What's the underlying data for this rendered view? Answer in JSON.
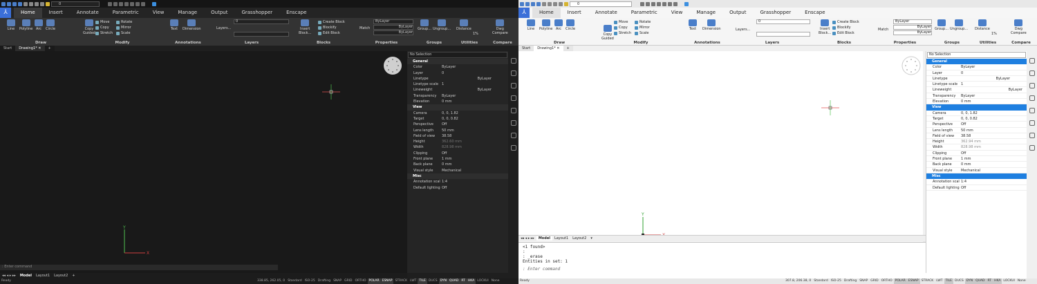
{
  "qat": {
    "layer_value": "0"
  },
  "tabs": [
    "Home",
    "Insert",
    "Annotate",
    "Parametric",
    "View",
    "Manage",
    "Output",
    "Grasshopper",
    "Enscape"
  ],
  "ribbon": {
    "groups": {
      "draw": "Draw",
      "modify": "Modify",
      "annotations": "Annotations",
      "layers": "Layers",
      "blocks": "Blocks",
      "properties": "Properties",
      "groups": "Groups",
      "utilities": "Utilities",
      "compare": "Compare"
    },
    "draw": [
      "Line",
      "Polyline",
      "Arc",
      "Circle"
    ],
    "modify_big": [
      "Copy",
      "Guided"
    ],
    "modify_small": [
      "Move",
      "Rotate",
      "Copy",
      "Mirror",
      "Stretch",
      "Scale"
    ],
    "annot": [
      "Text",
      "Dimension"
    ],
    "layers_btn": "Layers...",
    "layer_value": "0",
    "blocks": {
      "insert": "Insert",
      "insert2": "Block...",
      "create": "Create Block",
      "blockify": "Blockify",
      "edit": "Edit Block"
    },
    "match": "Match",
    "bylayer": [
      "ByLayer",
      "ByLayer",
      "ByLayer"
    ],
    "groups_btn": [
      "Group...",
      "Ungroup..."
    ],
    "distance": "Distance",
    "percent": "1%",
    "dwg": [
      "Dwg",
      "Compare"
    ]
  },
  "doc_tabs": [
    "Start",
    "Drawing1*"
  ],
  "props": {
    "selection": "No Selection",
    "sections": [
      {
        "title": "General",
        "rows": [
          [
            "Color",
            "ByLayer"
          ],
          [
            "Layer",
            "0"
          ],
          [
            "Linetype",
            "ByLayer"
          ],
          [
            "Linetype scale",
            "1"
          ],
          [
            "Lineweight",
            "ByLayer"
          ],
          [
            "Transparency",
            "ByLayer"
          ],
          [
            "Elevation",
            "0 mm"
          ]
        ]
      },
      {
        "title": "View",
        "rows": [
          [
            "Camera",
            "0, 0, 1.82"
          ],
          [
            "Target",
            "0, 0, 0.82"
          ],
          [
            "Perspective",
            "Off"
          ],
          [
            "Lens length",
            "50 mm"
          ],
          [
            "Field of view",
            "38.58"
          ],
          [
            "Height",
            "362.60 mm"
          ],
          [
            "Width",
            "828.98 mm"
          ],
          [
            "Clipping",
            "Off"
          ],
          [
            "Front plane",
            "1 mm"
          ],
          [
            "Back plane",
            "0 mm"
          ],
          [
            "Visual style",
            "Mechanical"
          ]
        ]
      },
      {
        "title": "Misc",
        "rows": [
          [
            "Annotation scale",
            "1:4"
          ],
          [
            "Default lighting",
            "Off"
          ]
        ]
      }
    ],
    "light_height": "362.94 mm"
  },
  "layouts": [
    "Model",
    "Layout1",
    "Layout2"
  ],
  "command_placeholder": ": Enter command",
  "history": [
    "<1 found>",
    ":",
    ": _erase",
    "Entities in set: 1"
  ],
  "status": {
    "ready": "Ready",
    "coords_dark": "338.85, 262.05, 0",
    "coords_light": "307.8, 206.38, 0",
    "standard": "Standard",
    "iso": "ISO-25",
    "drafting": "Drafting",
    "toggles": [
      "SNAP",
      "GRID",
      "ORTHO",
      "POLAR",
      "ESNAP",
      "STRACK",
      "LWT",
      "TILE",
      "DUCS",
      "DYN",
      "QUAD",
      "RT",
      "HKA",
      "LOCKUI",
      "None"
    ]
  },
  "axis": {
    "x": "X",
    "y": "Y"
  }
}
